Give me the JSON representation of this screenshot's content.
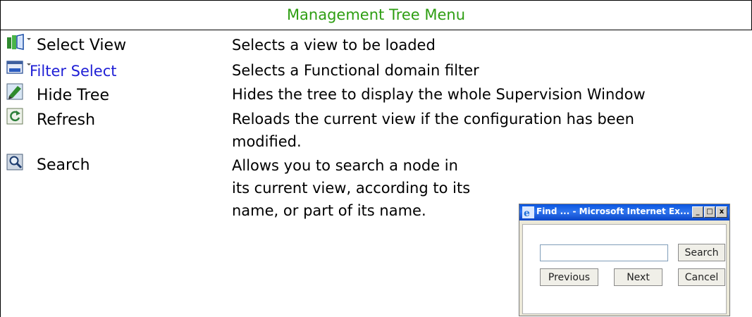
{
  "title": "Management Tree Menu",
  "rows": [
    {
      "label": "Select View",
      "description": "Selects a view to be loaded",
      "icon": "select-view-icon"
    },
    {
      "label": "Filter Select",
      "description": "Selects a Functional domain filter",
      "icon": "filter-select-icon"
    },
    {
      "label": "Hide Tree",
      "description": "Hides the tree to display the whole Supervision Window",
      "icon": "hide-tree-icon"
    },
    {
      "label": "Refresh",
      "description_lines": [
        "Reloads the current view if the configuration has been",
        "modified."
      ],
      "icon": "refresh-icon"
    },
    {
      "label": "Search",
      "description_lines": [
        "Allows you to search a node in",
        "its current view, according to its",
        "name, or part of its name."
      ],
      "icon": "search-icon"
    }
  ],
  "find_dialog": {
    "title": "Find ... - Microsoft Internet Ex...",
    "controls": [
      "_",
      "□",
      "x"
    ],
    "search_value": "",
    "buttons": {
      "search": "Search",
      "previous": "Previous",
      "next": "Next",
      "cancel": "Cancel"
    }
  },
  "colors": {
    "title": "#2e9e12",
    "filter_label": "#1f1fd6",
    "dialog_titlebar": "#0a56e0"
  }
}
